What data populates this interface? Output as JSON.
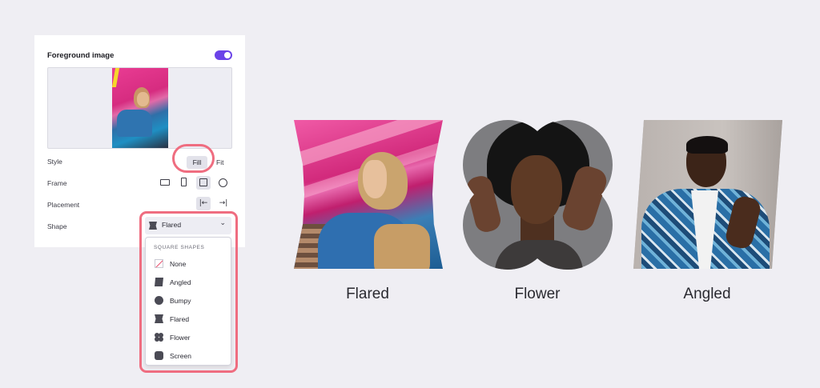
{
  "panel": {
    "title": "Foreground image",
    "toggle_on": true,
    "accent_color": "#6b43e8",
    "style": {
      "label": "Style",
      "options": [
        "Fill",
        "Fit"
      ],
      "selected": "Fill"
    },
    "frame": {
      "label": "Frame",
      "options": [
        "landscape-frame-icon",
        "portrait-frame-icon",
        "square-frame-icon",
        "circle-frame-icon"
      ],
      "selected": "square-frame-icon"
    },
    "placement": {
      "label": "Placement",
      "left_glyph": "|←",
      "right_glyph": "→|",
      "selected": "left"
    },
    "shape": {
      "label": "Shape",
      "selected": "Flared",
      "chevron": "⌄",
      "menu": {
        "header": "SQUARE SHAPES",
        "items": [
          "None",
          "Angled",
          "Bumpy",
          "Flared",
          "Flower",
          "Screen"
        ]
      }
    },
    "highlight_color": "#ef6d80"
  },
  "gallery": {
    "captions": [
      "Flared",
      "Flower",
      "Angled"
    ]
  }
}
